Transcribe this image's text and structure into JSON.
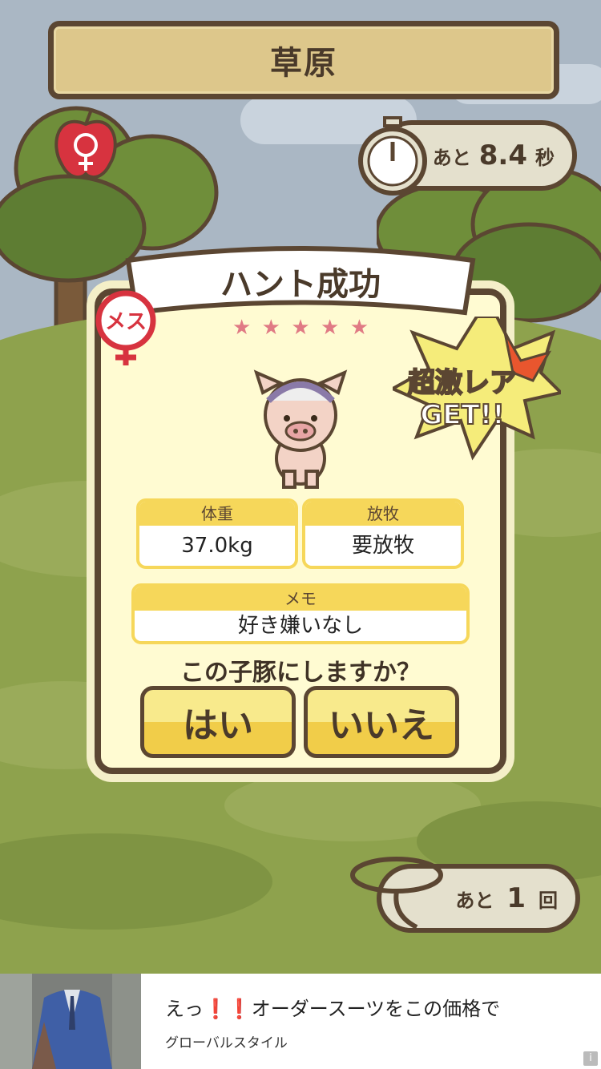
{
  "header": {
    "location": "草原"
  },
  "timer": {
    "prefix": "あと",
    "value": "8.4",
    "unit": "秒"
  },
  "result": {
    "title": "ハント成功",
    "stars": [
      "★",
      "★",
      "★",
      "★",
      "★"
    ],
    "gender_badge": "メス",
    "rare_label_line1": "超激レア",
    "rare_label_line2": "GET!!",
    "stats": {
      "weight_label": "体重",
      "weight_value": "37.0kg",
      "grazing_label": "放牧",
      "grazing_value": "要放牧",
      "memo_label": "メモ",
      "memo_value": "好き嫌いなし"
    },
    "question": "この子豚にしますか？",
    "yes_label": "はい",
    "no_label": "いいえ"
  },
  "remaining": {
    "prefix": "あと",
    "value": "1",
    "unit": "回"
  },
  "ad": {
    "title": "えっ❗❗オーダースーツをこの価格で",
    "sponsor": "グローバルスタイル",
    "info_icon": "i"
  },
  "colors": {
    "frame": "#5b4632",
    "card": "#fffbd2",
    "accent_yellow": "#f6d75a",
    "ground": "#8ea24d",
    "female_red": "#d7333f"
  }
}
